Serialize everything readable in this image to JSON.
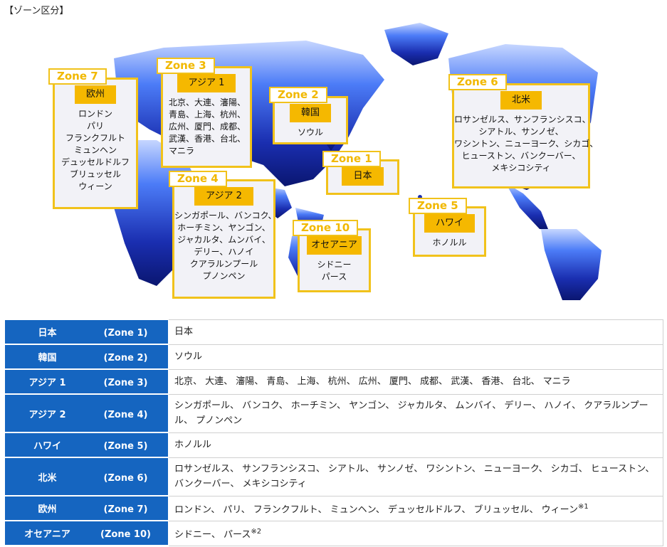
{
  "section_title": "【ゾーン区分】",
  "map_boxes": [
    {
      "tag": "Zone 7",
      "region": "欧州",
      "cities": [
        "ロンドン",
        "パリ",
        "フランクフルト",
        "ミュンヘン",
        "デュッセルドルフ",
        "ブリュッセル",
        "ウィーン"
      ]
    },
    {
      "tag": "Zone 3",
      "region": "アジア 1",
      "cities": [
        "北京、大連、瀋陽、",
        "青島、上海、杭州、",
        "広州、厦門、成都、",
        "武漢、香港、台北、",
        "マニラ"
      ]
    },
    {
      "tag": "Zone 2",
      "region": "韓国",
      "cities": [
        "ソウル"
      ]
    },
    {
      "tag": "Zone 1",
      "region": "日本",
      "cities": []
    },
    {
      "tag": "Zone 4",
      "region": "アジア 2",
      "cities": [
        "シンガポール、バンコク、",
        "ホーチミン、ヤンゴン、",
        "ジャカルタ、ムンバイ、",
        "デリー、ハノイ",
        "クアラルンプール",
        "プノンペン"
      ]
    },
    {
      "tag": "Zone 10",
      "region": "オセアニア",
      "cities": [
        "シドニー",
        "パース"
      ]
    },
    {
      "tag": "Zone 6",
      "region": "北米",
      "cities": [
        "ロサンゼルス、サンフランシスコ、",
        "シアトル、サンノゼ、",
        "ワシントン、ニューヨーク、シカゴ、",
        "ヒューストン、バンクーバー、",
        "メキシコシティ"
      ]
    },
    {
      "tag": "Zone 5",
      "region": "ハワイ",
      "cities": [
        "ホノルル"
      ]
    }
  ],
  "table_rows": [
    {
      "name": "日本",
      "zone": "(Zone 1)",
      "cities": "日本",
      "note": ""
    },
    {
      "name": "韓国",
      "zone": "(Zone 2)",
      "cities": "ソウル",
      "note": ""
    },
    {
      "name": "アジア 1",
      "zone": "(Zone 3)",
      "cities": "北京、 大連、 瀋陽、 青島、 上海、 杭州、 広州、 厦門、 成都、 武漢、 香港、 台北、 マニラ",
      "note": ""
    },
    {
      "name": "アジア 2",
      "zone": "(Zone 4)",
      "cities": "シンガポール、 バンコク、 ホーチミン、 ヤンゴン、 ジャカルタ、 ムンバイ、 デリー、 ハノイ、 クアラルンプール、 プノンペン",
      "note": ""
    },
    {
      "name": "ハワイ",
      "zone": "(Zone 5)",
      "cities": "ホノルル",
      "note": ""
    },
    {
      "name": "北米",
      "zone": "(Zone 6)",
      "cities": "ロサンゼルス、 サンフランシスコ、 シアトル、 サンノゼ、 ワシントン、 ニューヨーク、 シカゴ、 ヒューストン、 バンクーバー、 メキシコシティ",
      "note": ""
    },
    {
      "name": "欧州",
      "zone": "(Zone 7)",
      "cities": "ロンドン、 パリ、 フランクフルト、 ミュンヘン、 デュッセルドルフ、 ブリュッセル、 ウィーン",
      "note": "※1"
    },
    {
      "name": "オセアニア",
      "zone": "(Zone 10)",
      "cities": "シドニー、 パース",
      "note": "※2"
    }
  ],
  "colors": {
    "accent_yellow": "#f1c21b",
    "header_blue": "#1565c0",
    "map_deep": "#0a1a8a",
    "map_light": "#5a8cff"
  }
}
